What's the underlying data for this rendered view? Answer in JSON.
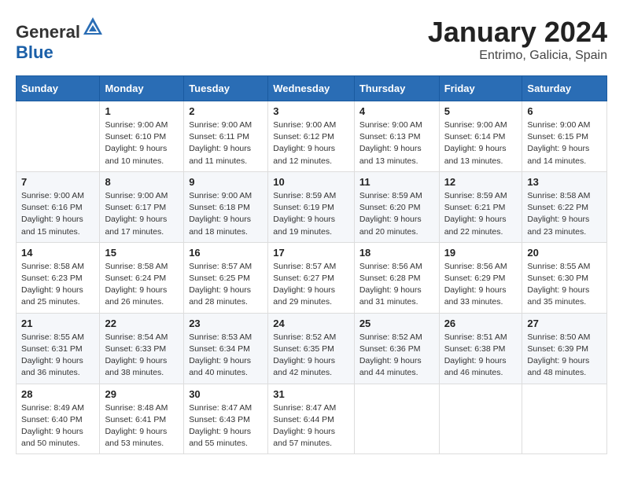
{
  "header": {
    "logo_general": "General",
    "logo_blue": "Blue",
    "month": "January 2024",
    "location": "Entrimo, Galicia, Spain"
  },
  "days_of_week": [
    "Sunday",
    "Monday",
    "Tuesday",
    "Wednesday",
    "Thursday",
    "Friday",
    "Saturday"
  ],
  "weeks": [
    [
      {
        "day": "",
        "info": ""
      },
      {
        "day": "1",
        "info": "Sunrise: 9:00 AM\nSunset: 6:10 PM\nDaylight: 9 hours\nand 10 minutes."
      },
      {
        "day": "2",
        "info": "Sunrise: 9:00 AM\nSunset: 6:11 PM\nDaylight: 9 hours\nand 11 minutes."
      },
      {
        "day": "3",
        "info": "Sunrise: 9:00 AM\nSunset: 6:12 PM\nDaylight: 9 hours\nand 12 minutes."
      },
      {
        "day": "4",
        "info": "Sunrise: 9:00 AM\nSunset: 6:13 PM\nDaylight: 9 hours\nand 13 minutes."
      },
      {
        "day": "5",
        "info": "Sunrise: 9:00 AM\nSunset: 6:14 PM\nDaylight: 9 hours\nand 13 minutes."
      },
      {
        "day": "6",
        "info": "Sunrise: 9:00 AM\nSunset: 6:15 PM\nDaylight: 9 hours\nand 14 minutes."
      }
    ],
    [
      {
        "day": "7",
        "info": "Sunrise: 9:00 AM\nSunset: 6:16 PM\nDaylight: 9 hours\nand 15 minutes."
      },
      {
        "day": "8",
        "info": "Sunrise: 9:00 AM\nSunset: 6:17 PM\nDaylight: 9 hours\nand 17 minutes."
      },
      {
        "day": "9",
        "info": "Sunrise: 9:00 AM\nSunset: 6:18 PM\nDaylight: 9 hours\nand 18 minutes."
      },
      {
        "day": "10",
        "info": "Sunrise: 8:59 AM\nSunset: 6:19 PM\nDaylight: 9 hours\nand 19 minutes."
      },
      {
        "day": "11",
        "info": "Sunrise: 8:59 AM\nSunset: 6:20 PM\nDaylight: 9 hours\nand 20 minutes."
      },
      {
        "day": "12",
        "info": "Sunrise: 8:59 AM\nSunset: 6:21 PM\nDaylight: 9 hours\nand 22 minutes."
      },
      {
        "day": "13",
        "info": "Sunrise: 8:58 AM\nSunset: 6:22 PM\nDaylight: 9 hours\nand 23 minutes."
      }
    ],
    [
      {
        "day": "14",
        "info": "Sunrise: 8:58 AM\nSunset: 6:23 PM\nDaylight: 9 hours\nand 25 minutes."
      },
      {
        "day": "15",
        "info": "Sunrise: 8:58 AM\nSunset: 6:24 PM\nDaylight: 9 hours\nand 26 minutes."
      },
      {
        "day": "16",
        "info": "Sunrise: 8:57 AM\nSunset: 6:25 PM\nDaylight: 9 hours\nand 28 minutes."
      },
      {
        "day": "17",
        "info": "Sunrise: 8:57 AM\nSunset: 6:27 PM\nDaylight: 9 hours\nand 29 minutes."
      },
      {
        "day": "18",
        "info": "Sunrise: 8:56 AM\nSunset: 6:28 PM\nDaylight: 9 hours\nand 31 minutes."
      },
      {
        "day": "19",
        "info": "Sunrise: 8:56 AM\nSunset: 6:29 PM\nDaylight: 9 hours\nand 33 minutes."
      },
      {
        "day": "20",
        "info": "Sunrise: 8:55 AM\nSunset: 6:30 PM\nDaylight: 9 hours\nand 35 minutes."
      }
    ],
    [
      {
        "day": "21",
        "info": "Sunrise: 8:55 AM\nSunset: 6:31 PM\nDaylight: 9 hours\nand 36 minutes."
      },
      {
        "day": "22",
        "info": "Sunrise: 8:54 AM\nSunset: 6:33 PM\nDaylight: 9 hours\nand 38 minutes."
      },
      {
        "day": "23",
        "info": "Sunrise: 8:53 AM\nSunset: 6:34 PM\nDaylight: 9 hours\nand 40 minutes."
      },
      {
        "day": "24",
        "info": "Sunrise: 8:52 AM\nSunset: 6:35 PM\nDaylight: 9 hours\nand 42 minutes."
      },
      {
        "day": "25",
        "info": "Sunrise: 8:52 AM\nSunset: 6:36 PM\nDaylight: 9 hours\nand 44 minutes."
      },
      {
        "day": "26",
        "info": "Sunrise: 8:51 AM\nSunset: 6:38 PM\nDaylight: 9 hours\nand 46 minutes."
      },
      {
        "day": "27",
        "info": "Sunrise: 8:50 AM\nSunset: 6:39 PM\nDaylight: 9 hours\nand 48 minutes."
      }
    ],
    [
      {
        "day": "28",
        "info": "Sunrise: 8:49 AM\nSunset: 6:40 PM\nDaylight: 9 hours\nand 50 minutes."
      },
      {
        "day": "29",
        "info": "Sunrise: 8:48 AM\nSunset: 6:41 PM\nDaylight: 9 hours\nand 53 minutes."
      },
      {
        "day": "30",
        "info": "Sunrise: 8:47 AM\nSunset: 6:43 PM\nDaylight: 9 hours\nand 55 minutes."
      },
      {
        "day": "31",
        "info": "Sunrise: 8:47 AM\nSunset: 6:44 PM\nDaylight: 9 hours\nand 57 minutes."
      },
      {
        "day": "",
        "info": ""
      },
      {
        "day": "",
        "info": ""
      },
      {
        "day": "",
        "info": ""
      }
    ]
  ]
}
